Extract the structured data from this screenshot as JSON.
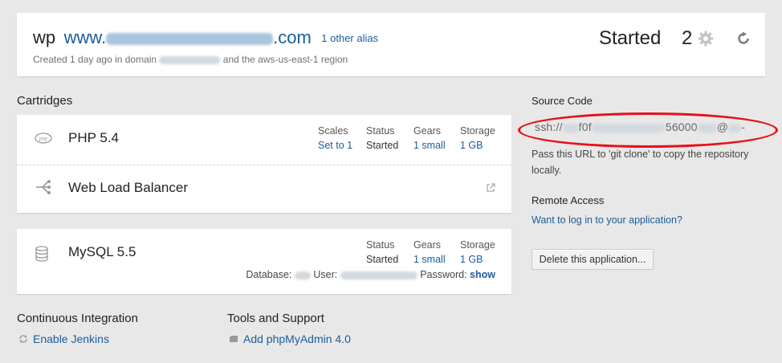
{
  "header": {
    "app_name": "wp",
    "domain_prefix": "www.",
    "domain_suffix": ".com",
    "alias_link": "1 other alias",
    "meta_prefix": "Created 1 day ago in domain",
    "meta_suffix": "and the aws-us-east-1 region",
    "state": "Started",
    "gear_count": "2"
  },
  "cartridges_title": "Cartridges",
  "cartridges": {
    "php": {
      "name": "PHP 5.4",
      "scales_label": "Scales",
      "scales_value": "Set to 1",
      "status_label": "Status",
      "status_value": "Started",
      "gears_label": "Gears",
      "gears_value": "1 small",
      "storage_label": "Storage",
      "storage_value": "1 GB"
    },
    "lb": {
      "name": "Web Load Balancer"
    },
    "mysql": {
      "name": "MySQL 5.5",
      "status_label": "Status",
      "status_value": "Started",
      "gears_label": "Gears",
      "gears_value": "1 small",
      "storage_label": "Storage",
      "storage_value": "1 GB",
      "database_label": "Database:",
      "user_label": "User:",
      "password_label": "Password:",
      "show_link": "show"
    }
  },
  "source_code": {
    "title": "Source Code",
    "url_start": "ssh://",
    "url_part2": "f0f",
    "url_part3": "56000",
    "url_part4": "@",
    "url_end": "-",
    "help": "Pass this URL to 'git clone' to copy the repository locally."
  },
  "remote_access": {
    "title": "Remote Access",
    "link": "Want to log in to your application?"
  },
  "delete_button": "Delete this application...",
  "ci": {
    "title": "Continuous Integration",
    "link": "Enable Jenkins"
  },
  "tools": {
    "title": "Tools and Support",
    "link": "Add phpMyAdmin 4.0"
  },
  "colors": {
    "link": "#1a5d9a",
    "annotation_red": "#e8101a",
    "background": "#e8e8e8"
  }
}
